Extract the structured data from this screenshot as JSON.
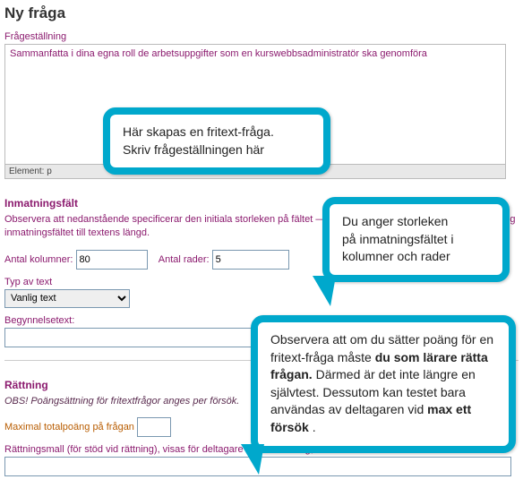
{
  "page": {
    "title": "Ny fråga"
  },
  "editor": {
    "label": "Frågeställning",
    "content": "Sammanfatta i dina egna roll de arbetsuppgifter som en kurswebbsadministratör ska genomföra",
    "footer": "Element: p"
  },
  "input_section": {
    "heading": "Inmatningsfält",
    "help": "Observera att nedanstående specificerar den initiala storleken på fältet — när deltagaren fyller i sitt svar anpassar sig inmatningsfältet till textens längd.",
    "cols_label": "Antal kolumner:",
    "cols_value": "80",
    "rows_label": "Antal rader:",
    "rows_value": "5",
    "type_label": "Typ av text",
    "type_value": "Vanlig text",
    "begin_label": "Begynnelsetext:",
    "begin_value": ""
  },
  "grading": {
    "heading": "Rättning",
    "obs": "OBS! Poängsättning för fritextfrågor anges per försök.",
    "max_label": "Maximal totalpoäng på frågan",
    "max_value": "",
    "mall_label": "Rättningsmall (för stöd vid rättning), visas för deltagare efter inlämning, om flera försök är tillåtna:",
    "mall_value": ""
  },
  "callouts": {
    "c1": {
      "line1": "Här skapas en fritext-fråga.",
      "line2": "Skriv frågeställningen här"
    },
    "c2": {
      "line1": "Du anger storleken",
      "line2": "på inmatningsfältet i",
      "line3": "kolumner och rader"
    },
    "c3": {
      "part1": "Observera att om du sätter poäng för en fritext-fråga måste ",
      "bold1": "du som lärare rätta frågan.",
      "part2": " Därmed är det inte längre en självtest. Dessutom kan testet bara användas av deltagaren vid ",
      "bold2": "max ett försök",
      "part3": "."
    }
  }
}
